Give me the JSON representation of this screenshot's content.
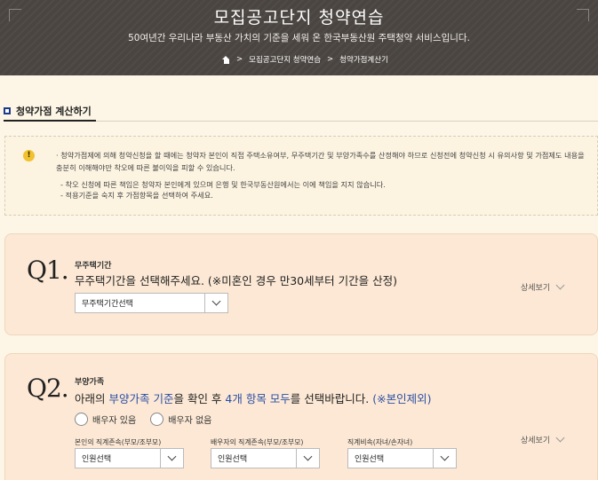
{
  "header": {
    "title": "모집공고단지 청약연습",
    "subtitle": "50여년간 우리나라 부동산 가치의 기준을 세워 온 한국부동산원 주택청약 서비스입니다.",
    "breadcrumb": [
      "모집공고단지 청약연습",
      "청약가점계산기"
    ],
    "home_icon": "home-icon"
  },
  "tab": {
    "title": "청약가점 계산하기"
  },
  "notice": {
    "icon": "warning-icon",
    "line1": "· 청약가점제에 의해 청약신청을 할 때에는 청약자 본인이 직접 주택소유여부, 무주택기간 및 부양가족수를 산정해야 하므로 신청전에 청약신청 시 유의사항 및 가점제도 내용을 충분히 이해해야만 착오에 따른 불이익을 피할 수 있습니다.",
    "line2": "- 착오 신청에 따른 책임은 청약자 본인에게 있으며 은행 및 한국부동산원에서는 이에 책임을 지지 않습니다.",
    "line3": "- 적용기준을 숙지 후 가점항목을 선택하여 주세요."
  },
  "q1": {
    "number": "Q1.",
    "label": "무주택기간",
    "question": "무주택기간을 선택해주세요. (※미혼인 경우 만30세부터 기간을 산정)",
    "select_value": "무주택기간선택",
    "detail": "상세보기"
  },
  "q2": {
    "number": "Q2.",
    "label": "부양가족",
    "question_pre": "아래의 ",
    "question_hl1": "부양가족 기준",
    "question_mid": "을 확인 후 ",
    "question_hl2": "4개 항목 모두",
    "question_post": "를 선택바랍니다. ",
    "question_hl3": "(※본인제외)",
    "radio1": "배우자 있음",
    "radio2": "배우자 없음",
    "field1_label": "본인의 직계존속(부모/조부모)",
    "field2_label": "배우자의 직계존속(부모/조부모)",
    "field3_label": "직계비속(자녀/손자녀)",
    "field1_value": "인원선택",
    "field2_value": "인원선택",
    "field3_value": "인원선택",
    "detail": "상세보기"
  }
}
